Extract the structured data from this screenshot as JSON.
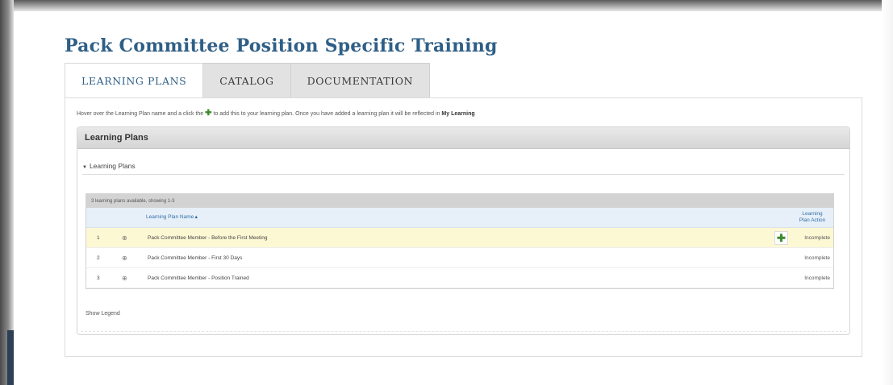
{
  "page": {
    "title": "Pack Committee Position Specific Training"
  },
  "tabs": [
    {
      "label": "LEARNING PLANS",
      "active": true
    },
    {
      "label": "CATALOG",
      "active": false
    },
    {
      "label": "DOCUMENTATION",
      "active": false
    }
  ],
  "hint": {
    "before": "Hover over the Learning Plan name and a click the",
    "after": "to add this to your learning plan. Once you have added a learning plan it will be reflected in",
    "link": "My Learning"
  },
  "panel": {
    "header": "Learning Plans",
    "section_label": "Learning Plans"
  },
  "grid": {
    "status_text": "3 learning plans available, showing 1-3",
    "col_name": "Learning Plan Name",
    "col_action": "Learning Plan Action",
    "rows": [
      {
        "num": "1",
        "name": "Pack Committee Member - Before the First Meeting",
        "status": "Incomplete",
        "highlighted": true
      },
      {
        "num": "2",
        "name": "Pack Committee Member - First 30 Days",
        "status": "Incomplete",
        "highlighted": false
      },
      {
        "num": "3",
        "name": "Pack Committee Member - Position Trained",
        "status": "Incomplete",
        "highlighted": false
      }
    ]
  },
  "legend_label": "Show Legend",
  "icons": {
    "add": "plus-icon",
    "info": "info-icon",
    "collapse": "triangle-down-icon",
    "sort": "sort-asc-icon"
  },
  "colors": {
    "title": "#2f5f86",
    "add_icon": "#3d8a2a",
    "highlight_row": "#fdf8d4",
    "grid_header": "#e7f0f8"
  }
}
